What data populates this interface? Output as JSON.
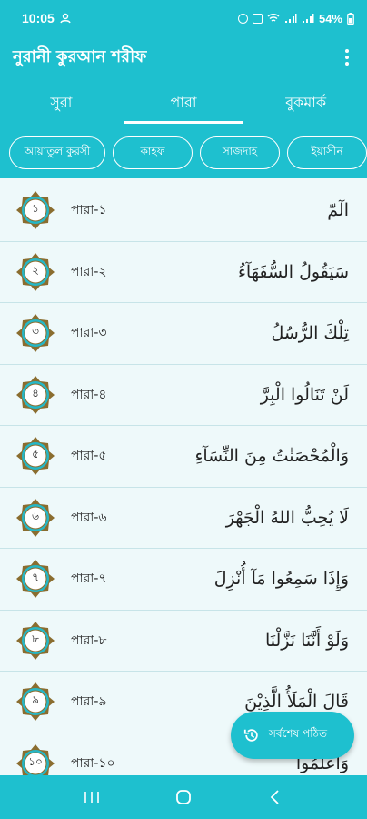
{
  "status": {
    "time": "10:05",
    "battery": "54%"
  },
  "app": {
    "title": "নুরানী কুরআন শরীফ"
  },
  "tabs": [
    {
      "label": "সুরা"
    },
    {
      "label": "পারা"
    },
    {
      "label": "বুকমার্ক"
    }
  ],
  "chips": [
    {
      "label": "আয়াতুল কুরসী"
    },
    {
      "label": "কাহফ"
    },
    {
      "label": "সাজদাহ"
    },
    {
      "label": "ইয়াসীন"
    }
  ],
  "paras": [
    {
      "num": "১",
      "label": "পারা-১",
      "arabic": "الٓمّٓ"
    },
    {
      "num": "২",
      "label": "পারা-২",
      "arabic": "سَيَقُولُ السُّفَهَآءُ"
    },
    {
      "num": "৩",
      "label": "পারা-৩",
      "arabic": "تِلْكَ الرُّسُلُ"
    },
    {
      "num": "৪",
      "label": "পারা-৪",
      "arabic": "لَنْ تَنَالُوا الْبِرَّ"
    },
    {
      "num": "৫",
      "label": "পারা-৫",
      "arabic": "وَالْمُحْصَنٰتُ مِنَ النِّسَآءِ"
    },
    {
      "num": "৬",
      "label": "পারা-৬",
      "arabic": "لَا يُحِبُّ اللهُ الْجَهْرَ"
    },
    {
      "num": "৭",
      "label": "পারা-৭",
      "arabic": "وَإِذَا سَمِعُوا مَآ أُنْزِلَ"
    },
    {
      "num": "৮",
      "label": "পারা-৮",
      "arabic": "وَلَوْ أَنَّنَا نَزَّلْنَا"
    },
    {
      "num": "৯",
      "label": "পারা-৯",
      "arabic": "قَالَ الْمَلَأُ الَّذِيْنَ"
    },
    {
      "num": "১০",
      "label": "পারা-১০",
      "arabic": "وَاعْلَمُوا"
    }
  ],
  "fab": {
    "label": "সর্বশেষ পঠিত",
    "icon": "history-icon"
  },
  "colors": {
    "primary": "#1ec0cf",
    "background": "#eef9fa",
    "badge_gold": "#8a6d2f",
    "badge_ring": "#26b7c6"
  }
}
